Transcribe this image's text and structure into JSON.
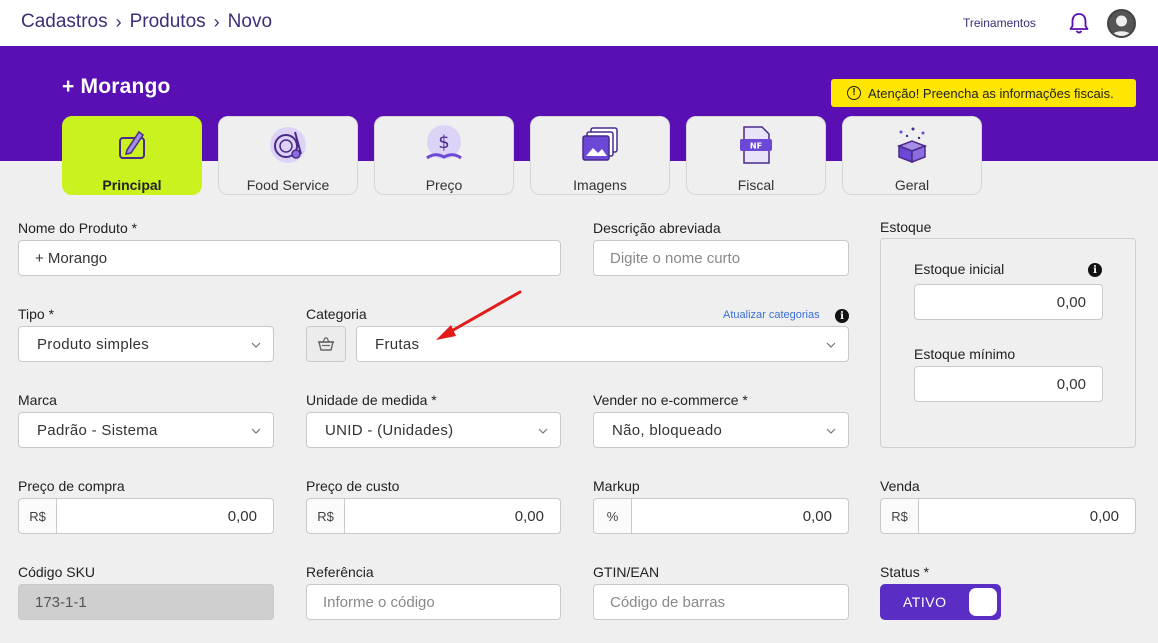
{
  "breadcrumb": [
    "Cadastros",
    "Produtos",
    "Novo"
  ],
  "header": {
    "trainings": "Treinamentos"
  },
  "page": {
    "title": "+ Morango",
    "alert": "Atenção! Preencha as informações fiscais."
  },
  "tabs": [
    {
      "label": "Principal",
      "icon": "pencil-document-icon",
      "active": true
    },
    {
      "label": "Food Service",
      "icon": "plate-utensils-icon",
      "active": false
    },
    {
      "label": "Preço",
      "icon": "money-hand-icon",
      "active": false
    },
    {
      "label": "Imagens",
      "icon": "image-gallery-icon",
      "active": false
    },
    {
      "label": "Fiscal",
      "icon": "nf-document-icon",
      "active": false
    },
    {
      "label": "Geral",
      "icon": "gift-box-icon",
      "active": false
    }
  ],
  "form": {
    "nome_label": "Nome do Produto *",
    "nome_value": "+ Morango",
    "descricao_label": "Descrição abreviada",
    "descricao_placeholder": "Digite o nome curto",
    "tipo_label": "Tipo *",
    "tipo_value": "Produto simples",
    "categoria_label": "Categoria",
    "atualizar_link": "Atualizar categorias",
    "categoria_value": "Frutas",
    "marca_label": "Marca",
    "marca_value": "Padrão - Sistema",
    "unidade_label": "Unidade de medida *",
    "unidade_value": "UNID - (Unidades)",
    "ecommerce_label": "Vender no e-commerce *",
    "ecommerce_value": "Não, bloqueado",
    "preco_compra_label": "Preço de compra",
    "preco_compra_prefix": "R$",
    "preco_compra_value": "0,00",
    "preco_custo_label": "Preço de custo",
    "preco_custo_prefix": "R$",
    "preco_custo_value": "0,00",
    "markup_label": "Markup",
    "markup_prefix": "%",
    "markup_value": "0,00",
    "venda_label": "Venda",
    "venda_prefix": "R$",
    "venda_value": "0,00",
    "sku_label": "Código SKU",
    "sku_value": "173-1-1",
    "referencia_label": "Referência",
    "referencia_placeholder": "Informe o código",
    "gtin_label": "GTIN/EAN",
    "gtin_placeholder": "Código de barras",
    "status_label": "Status *",
    "status_value": "ATIVO"
  },
  "estoque": {
    "title": "Estoque",
    "inicial_label": "Estoque inicial",
    "inicial_value": "0,00",
    "minimo_label": "Estoque mínimo",
    "minimo_value": "0,00"
  },
  "colors": {
    "brand": "#5a0fb4",
    "active_tab": "#c9f21e",
    "alert": "#ffe600",
    "toggle": "#5a2ec4"
  }
}
